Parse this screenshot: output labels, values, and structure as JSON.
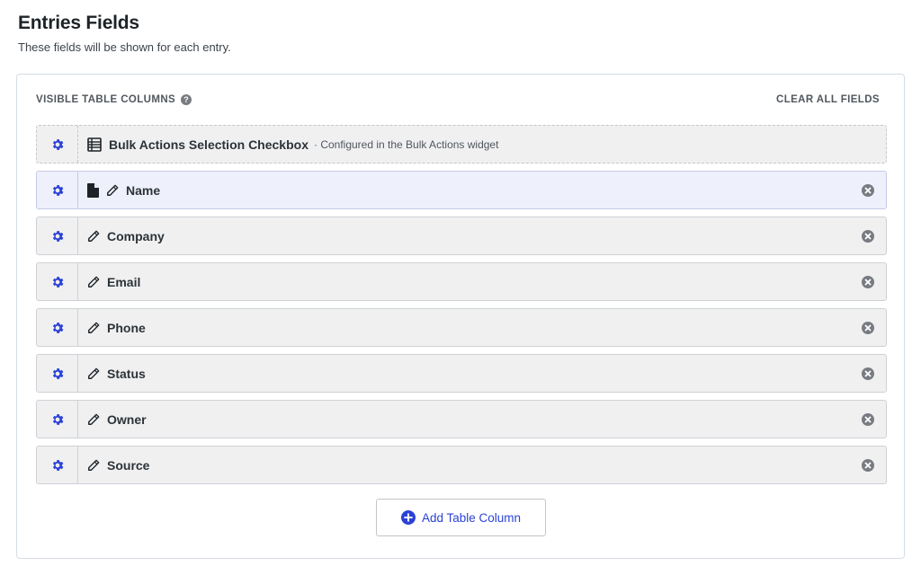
{
  "header": {
    "title": "Entries Fields",
    "description": "These fields will be shown for each entry."
  },
  "panel": {
    "section_label": "VISIBLE TABLE COLUMNS",
    "clear_all_label": "CLEAR ALL FIELDS",
    "bulk_row": {
      "label": "Bulk Actions Selection Checkbox",
      "note": "· Configured in the Bulk Actions widget"
    },
    "fields": [
      {
        "label": "Name"
      },
      {
        "label": "Company"
      },
      {
        "label": "Email"
      },
      {
        "label": "Phone"
      },
      {
        "label": "Status"
      },
      {
        "label": "Owner"
      },
      {
        "label": "Source"
      }
    ],
    "add_button_label": "Add Table Column"
  },
  "colors": {
    "accent": "#2c42d6",
    "row_bg": "#f0f0f1",
    "highlight_row_bg": "#eef0fb",
    "remove_icon": "#787c82"
  },
  "icons": {
    "settings": "gear-icon",
    "table": "table-icon",
    "document": "document-icon",
    "edit": "pencil-icon",
    "remove": "remove-icon",
    "help": "help-icon",
    "add": "plus-circle-icon"
  }
}
